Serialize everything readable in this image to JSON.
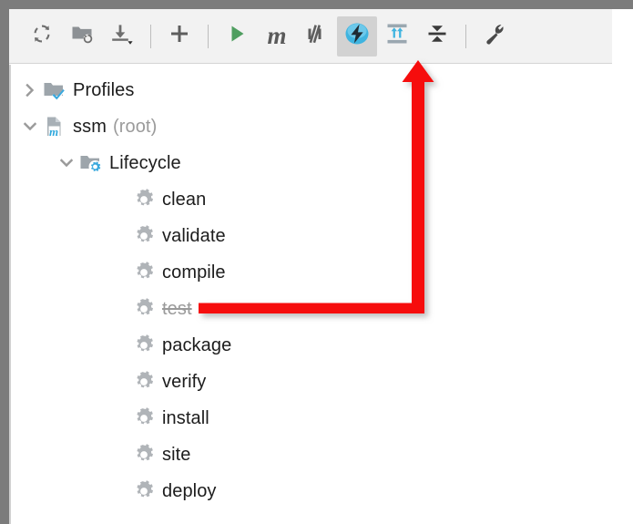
{
  "window": {
    "title": "Maven Projects Tool Window"
  },
  "toolbar": {
    "items": [
      {
        "name": "reload-all-maven-projects",
        "icon": "refresh-icon",
        "label": "Reload All Maven Projects"
      },
      {
        "name": "add-maven-project",
        "icon": "folder-refresh-icon",
        "label": "Generate Sources and Update Folders"
      },
      {
        "name": "download-sources",
        "icon": "download-dropdown-icon",
        "label": "Download Sources and/or Documentation"
      },
      {
        "name": "separator-1",
        "icon": "separator",
        "label": ""
      },
      {
        "name": "add-button",
        "icon": "plus-icon",
        "label": "Add Maven Project"
      },
      {
        "name": "separator-2",
        "icon": "separator",
        "label": ""
      },
      {
        "name": "run-button",
        "icon": "play-icon",
        "label": "Run Maven Build"
      },
      {
        "name": "execute-maven-goal",
        "icon": "maven-m-icon",
        "label": "Execute Maven Goal"
      },
      {
        "name": "toggle-offline-mode",
        "icon": "offline-mode-icon",
        "label": "Toggle Offline Mode"
      },
      {
        "name": "toggle-skip-tests",
        "icon": "skip-tests-lightning-icon",
        "label": "Toggle 'Skip Tests' Mode"
      },
      {
        "name": "expand-all",
        "icon": "expand-all-icon",
        "label": "Expand All"
      },
      {
        "name": "collapse-all",
        "icon": "collapse-all-icon",
        "label": "Collapse All"
      },
      {
        "name": "separator-3",
        "icon": "separator",
        "label": ""
      },
      {
        "name": "maven-settings",
        "icon": "wrench-icon",
        "label": "Maven Settings"
      }
    ],
    "selected_item": "toggle-skip-tests"
  },
  "tree": {
    "nodes": [
      {
        "label": "Profiles",
        "suffix": "",
        "icon": "profiles-folder-check-icon",
        "twisty": "collapsed",
        "indent": 0,
        "state": "normal"
      },
      {
        "label": "ssm",
        "suffix": "(root)",
        "icon": "maven-project-icon",
        "twisty": "expanded",
        "indent": 1,
        "state": "normal"
      },
      {
        "label": "Lifecycle",
        "suffix": "",
        "icon": "lifecycle-folder-gear-icon",
        "twisty": "expanded",
        "indent": 2,
        "state": "normal"
      },
      {
        "label": "clean",
        "suffix": "",
        "icon": "goal-gear-icon",
        "twisty": "none",
        "indent": 3,
        "state": "normal"
      },
      {
        "label": "validate",
        "suffix": "",
        "icon": "goal-gear-icon",
        "twisty": "none",
        "indent": 3,
        "state": "normal"
      },
      {
        "label": "compile",
        "suffix": "",
        "icon": "goal-gear-icon",
        "twisty": "none",
        "indent": 3,
        "state": "normal"
      },
      {
        "label": "test",
        "suffix": "",
        "icon": "goal-gear-icon",
        "twisty": "none",
        "indent": 3,
        "state": "skipped"
      },
      {
        "label": "package",
        "suffix": "",
        "icon": "goal-gear-icon",
        "twisty": "none",
        "indent": 3,
        "state": "normal"
      },
      {
        "label": "verify",
        "suffix": "",
        "icon": "goal-gear-icon",
        "twisty": "none",
        "indent": 3,
        "state": "normal"
      },
      {
        "label": "install",
        "suffix": "",
        "icon": "goal-gear-icon",
        "twisty": "none",
        "indent": 3,
        "state": "normal"
      },
      {
        "label": "site",
        "suffix": "",
        "icon": "goal-gear-icon",
        "twisty": "none",
        "indent": 3,
        "state": "normal"
      },
      {
        "label": "deploy",
        "suffix": "",
        "icon": "goal-gear-icon",
        "twisty": "none",
        "indent": 3,
        "state": "normal"
      }
    ]
  },
  "annotation": {
    "name": "red-elbow-arrow",
    "color": "#f60c0c",
    "points_from": "test",
    "points_to": "toggle-skip-tests"
  },
  "colors": {
    "accent_blue": "#30b0e0",
    "maven_green": "#59a869",
    "icon_gray": "#b0b4b8",
    "toolbar_bg": "#f2f2f2",
    "selected_bg": "#d2d2d2",
    "text": "#1c1c1c",
    "muted_text": "#9b9b9b",
    "annotation_red": "#f60c0c"
  }
}
